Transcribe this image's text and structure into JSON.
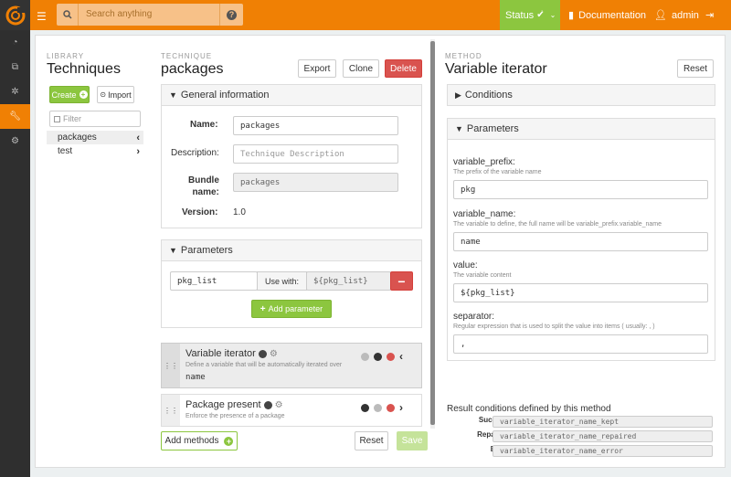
{
  "topbar": {
    "search_placeholder": "Search anything",
    "status_label": "Status",
    "documentation_label": "Documentation",
    "user_label": "admin",
    "colors": {
      "orange": "#f08004",
      "green": "#8cc63f"
    }
  },
  "library": {
    "caption": "LIBRARY",
    "title": "Techniques",
    "create_label": "Create",
    "import_label": "Import",
    "filter_placeholder": "Filter",
    "items": [
      {
        "label": "packages"
      },
      {
        "label": "test"
      }
    ]
  },
  "technique": {
    "caption": "TECHNIQUE",
    "title": "packages",
    "export_label": "Export",
    "clone_label": "Clone",
    "delete_label": "Delete",
    "general_header": "General information",
    "name_label": "Name:",
    "name_value": "packages",
    "description_label": "Description:",
    "description_placeholder": "Technique Description",
    "bundle_label_1": "Bundle",
    "bundle_label_2": "name:",
    "bundle_value": "packages",
    "version_label": "Version:",
    "version_value": "1.0",
    "parameters_header": "Parameters",
    "param_name": "pkg_list",
    "use_with_label": "Use with:",
    "param_usage": "${pkg_list}",
    "add_parameter_label": "Add parameter",
    "methods": [
      {
        "title": "Variable iterator",
        "desc": "Define a variable that will be automatically iterated over",
        "value": "name"
      },
      {
        "title": "Package present",
        "desc": "Enforce the presence of a package",
        "value": ""
      }
    ],
    "add_methods_label": "Add methods",
    "reset_label": "Reset",
    "save_label": "Save"
  },
  "method": {
    "caption": "METHOD",
    "title": "Variable iterator",
    "reset_label": "Reset",
    "conditions_header": "Conditions",
    "parameters_header": "Parameters",
    "params": [
      {
        "name": "variable_prefix:",
        "desc": "The prefix of the variable name",
        "value": "pkg"
      },
      {
        "name": "variable_name:",
        "desc": "The variable to define, the full name will be variable_prefix.variable_name",
        "value": "name"
      },
      {
        "name": "value:",
        "desc": "The variable content",
        "value": "${pkg_list}"
      },
      {
        "name": "separator:",
        "desc": "Regular expression that is used to split the value into items ( usually: , )",
        "value": ","
      }
    ],
    "result_title": "Result conditions defined by this method",
    "results": [
      {
        "label": "Success:",
        "value": "variable_iterator_name_kept"
      },
      {
        "label": "Repaired:",
        "value": "variable_iterator_name_repaired"
      },
      {
        "label": "Error:",
        "value": "variable_iterator_name_error"
      }
    ]
  }
}
